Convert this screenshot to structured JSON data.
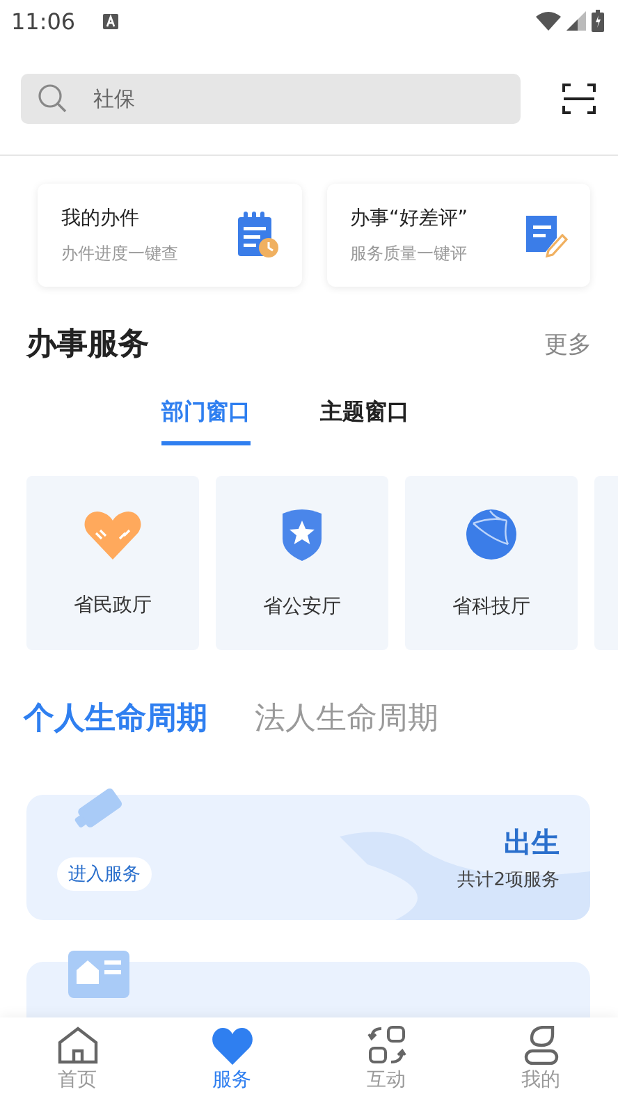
{
  "status_bar": {
    "time": "11:06"
  },
  "search": {
    "placeholder": "社保"
  },
  "quick_cards": [
    {
      "kind": "notebook",
      "title": "我的办件",
      "subtitle": "办件进度一键查"
    },
    {
      "kind": "note",
      "title": "办事“好差评”",
      "subtitle": "服务质量一键评"
    }
  ],
  "section": {
    "title": "办事服务",
    "more": "更多"
  },
  "tabs": [
    {
      "label": "部门窗口",
      "selected": true
    },
    {
      "label": "主题窗口",
      "selected": false
    }
  ],
  "departments": [
    {
      "kind": "heart",
      "name": "省民政厅"
    },
    {
      "kind": "shield",
      "name": "省公安厅"
    },
    {
      "kind": "globe",
      "name": "省科技厅"
    }
  ],
  "lifecycle_tabs": [
    {
      "label": "个人生命周期",
      "selected": true
    },
    {
      "label": "法人生命周期",
      "selected": false
    }
  ],
  "life_cards": [
    {
      "kind": "bottle",
      "title": "出生",
      "count": "共计2项服务",
      "button": "进入服务"
    },
    {
      "kind": "id-card"
    }
  ],
  "bottom_nav": [
    {
      "kind": "home",
      "label": "首页",
      "selected": false
    },
    {
      "kind": "heart",
      "label": "服务",
      "selected": true
    },
    {
      "kind": "swap",
      "label": "互动",
      "selected": false
    },
    {
      "kind": "person",
      "label": "我的",
      "selected": false
    }
  ]
}
